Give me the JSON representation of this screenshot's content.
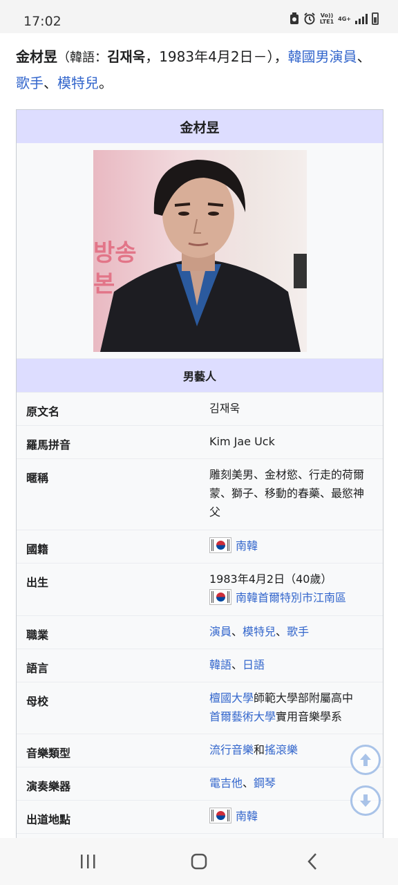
{
  "status_bar": {
    "time": "17:02",
    "indicators": [
      "alarm-icon",
      "volte-lte1",
      "4g-signal",
      "battery"
    ],
    "volte_label": "Vo))\nLTE1",
    "network_label": "4G+"
  },
  "article": {
    "lead_name": "金材昱",
    "lead_korean_label": "（韓語：",
    "lead_korean_name": "김재욱",
    "lead_dates": "，1983年4月2日－）",
    "lead_sep1": "，",
    "lead_link1": "韓國男演員",
    "lead_sep2": "、",
    "lead_link2": "歌手",
    "lead_sep3": "、",
    "lead_link3": "模特兒",
    "lead_end": "。"
  },
  "infobox": {
    "title": "金材昱",
    "image_alt": "portrait photo",
    "section": "男藝人",
    "rows": [
      {
        "label": "原文名",
        "value": "김재욱"
      },
      {
        "label": "羅馬拼音",
        "value": "Kim Jae Uck"
      },
      {
        "label": "暱稱",
        "value": "雕刻美男、金材慾、行走的荷爾蒙、獅子、移動的春藥、最慾神父"
      },
      {
        "label": "國籍",
        "link": "南韓"
      },
      {
        "label": "出生",
        "value": "1983年4月2日（40歲）",
        "link": "南韓首爾特別市江南區"
      },
      {
        "label": "職業",
        "link1": "演員",
        "sep1": "、",
        "link2": "模特兒",
        "sep2": "、",
        "link3": "歌手"
      },
      {
        "label": "語言",
        "link1": "韓語",
        "sep": "、",
        "link2": "日語"
      },
      {
        "label": "母校",
        "link1": "檀國大學",
        "text1": "師範大學部附屬高中",
        "link2": "首爾藝術大學",
        "text2": "實用音樂學系"
      },
      {
        "label": "音樂類型",
        "link1": "流行音樂",
        "text": "和",
        "link2": "搖滾樂"
      },
      {
        "label": "演奏樂器",
        "link1": "電吉他",
        "sep": "、",
        "link2": "鋼琴"
      },
      {
        "label": "出道地點",
        "link": "南韓"
      }
    ]
  },
  "colors": {
    "link": "#3366cc",
    "infobox_header": "#ddddff",
    "infobox_bg": "#f8f9fa",
    "fab_ring": "#a9c3e8"
  },
  "nav": [
    "recent-apps",
    "home",
    "back"
  ]
}
